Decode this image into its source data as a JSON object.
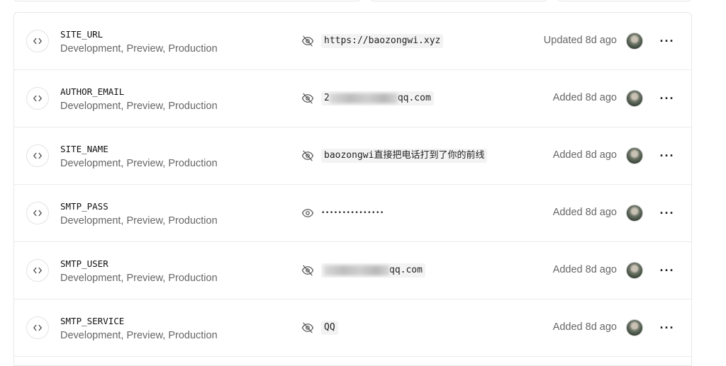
{
  "env_vars": [
    {
      "key": "SITE_URL",
      "environments": "Development, Preview, Production",
      "visibility": "hidden",
      "value": "https://baozongwi.xyz",
      "value_masked": false,
      "status": "Updated 8d ago"
    },
    {
      "key": "AUTHOR_EMAIL",
      "environments": "Development, Preview, Production",
      "visibility": "hidden",
      "value_prefix": "2",
      "value_suffix": "qq.com",
      "redacted": true,
      "status": "Added 8d ago"
    },
    {
      "key": "SITE_NAME",
      "environments": "Development, Preview, Production",
      "visibility": "hidden",
      "value": "baozongwi直接把电话打到了你的前线",
      "value_masked": false,
      "status": "Added 8d ago"
    },
    {
      "key": "SMTP_PASS",
      "environments": "Development, Preview, Production",
      "visibility": "shown",
      "value": "•••••••••••••••",
      "value_masked": true,
      "status": "Added 8d ago"
    },
    {
      "key": "SMTP_USER",
      "environments": "Development, Preview, Production",
      "visibility": "hidden",
      "value_prefix": "",
      "value_suffix": "qq.com",
      "redacted": true,
      "status": "Added 8d ago"
    },
    {
      "key": "SMTP_SERVICE",
      "environments": "Development, Preview, Production",
      "visibility": "hidden",
      "value": "QQ",
      "value_masked": false,
      "status": "Added 8d ago"
    }
  ],
  "icons": {
    "row_type": "code-brackets-icon",
    "hidden": "eye-off-icon",
    "shown": "eye-icon",
    "menu": "more-horizontal-icon",
    "user": "avatar"
  },
  "colors": {
    "border": "#e8e8e8",
    "muted_text": "#666666",
    "value_bg": "#f3f3f3"
  }
}
